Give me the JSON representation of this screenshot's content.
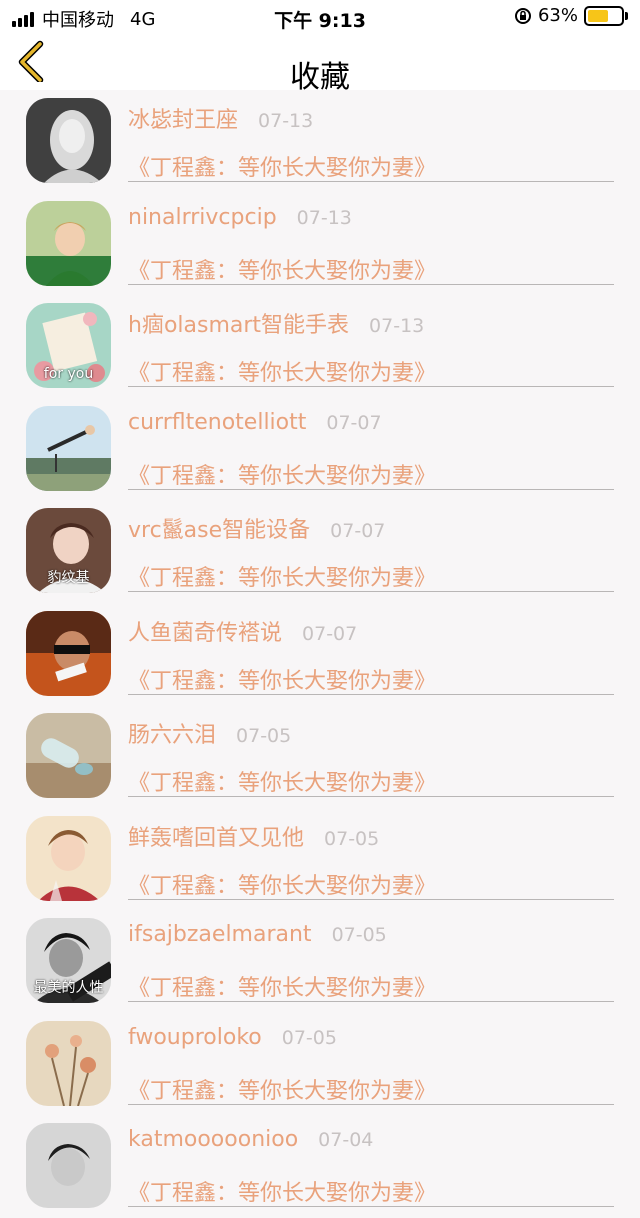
{
  "status_bar": {
    "carrier": "中国移动",
    "network": "4G",
    "time": "下午 9:13",
    "battery_percent": "63%",
    "battery_level": 0.63,
    "battery_color": "#f7c518"
  },
  "nav": {
    "back_icon": "chevron-left-icon",
    "title": "收藏"
  },
  "colors": {
    "accent": "#e9a27c",
    "date": "#c7c2c2",
    "back": "#e5b62c"
  },
  "favorites": [
    {
      "name": "冰毖封王座",
      "date": "07-13",
      "title": "《丁程鑫：等你长大娶你为妻》"
    },
    {
      "name": "ninalrrivcpcip",
      "date": "07-13",
      "title": "《丁程鑫：等你长大娶你为妻》"
    },
    {
      "name": "h痼olasmart智能手表",
      "date": "07-13",
      "title": "《丁程鑫：等你长大娶你为妻》",
      "avatar_text": "for you"
    },
    {
      "name": "currfltenotelliott",
      "date": "07-07",
      "title": "《丁程鑫：等你长大娶你为妻》"
    },
    {
      "name": "vrc鬣ase智能设备",
      "date": "07-07",
      "title": "《丁程鑫：等你长大娶你为妻》",
      "avatar_text": "豹纹基"
    },
    {
      "name": "人鱼菌奇传褡说",
      "date": "07-07",
      "title": "《丁程鑫：等你长大娶你为妻》"
    },
    {
      "name": "肠六六泪",
      "date": "07-05",
      "title": "《丁程鑫：等你长大娶你为妻》"
    },
    {
      "name": "鲜轰嗜回首又见他",
      "date": "07-05",
      "title": "《丁程鑫：等你长大娶你为妻》"
    },
    {
      "name": "ifsajbzaelmarant",
      "date": "07-05",
      "title": "《丁程鑫：等你长大娶你为妻》",
      "avatar_text": "最美的人性"
    },
    {
      "name": "fwouproloko",
      "date": "07-05",
      "title": "《丁程鑫：等你长大娶你为妻》"
    },
    {
      "name": "katmooooonioo",
      "date": "07-04",
      "title": "《丁程鑫：等你长大娶你为妻》"
    }
  ]
}
